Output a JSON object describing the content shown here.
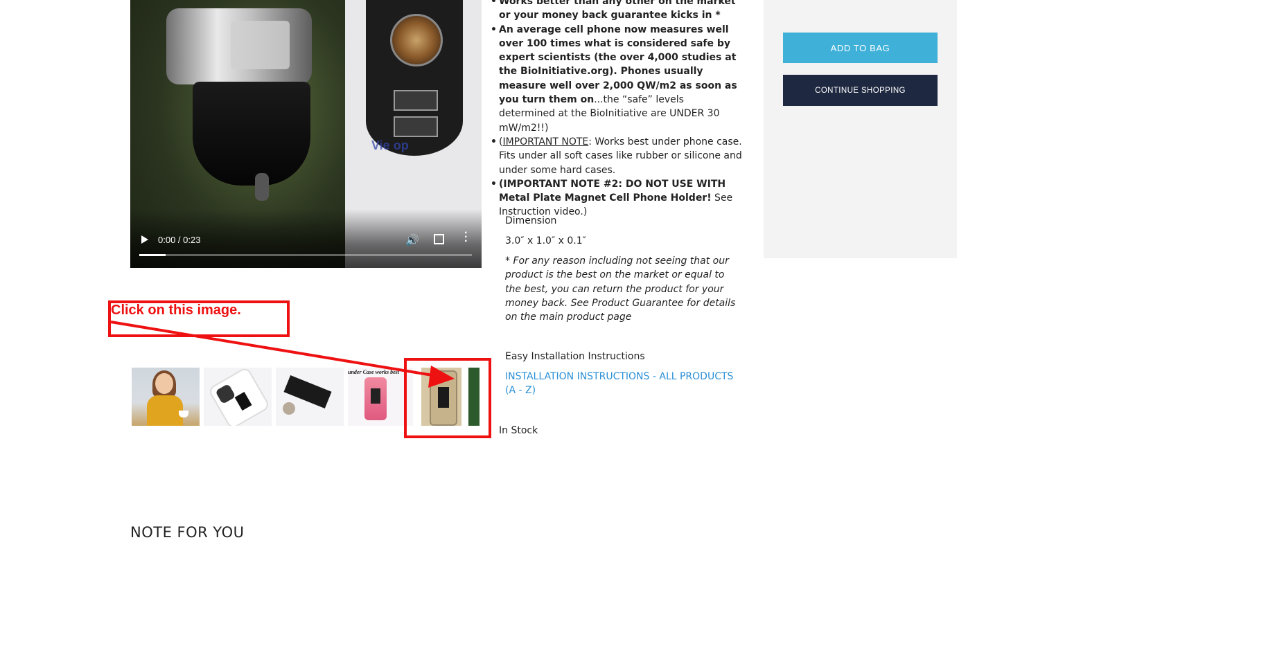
{
  "video": {
    "time": "0:00 / 0:23",
    "watermark": "Vie    op",
    "progress_fraction": 0.08
  },
  "annotation": {
    "text": "Click on this image."
  },
  "thumbnails": {
    "thumb4_caption": "under Case works best"
  },
  "description": {
    "bullet1": "Works better than any other on the market or your money back guarantee kicks in *",
    "bullet2_bold": "An average cell phone now measures well over 100 times what is considered safe by expert scientists (the over 4,000 studies at the BioInitiative.org). Phones usually measure well over 2,000 QW/m2 as soon as you turn them on",
    "bullet2_rest": "...the “safe” levels determined at the BioInitiative are UNDER 30 mW/m2!!)",
    "bullet3_open": "(",
    "bullet3_underlined": "IMPORTANT NOTE",
    "bullet3_rest": ":  Works best under phone case. Fits under all soft cases like rubber or silicone and under some hard cases.",
    "bullet4_bold": "(IMPORTANT NOTE #2:  DO NOT USE WITH Metal Plate Magnet Cell Phone Holder!",
    "bullet4_rest": "  See Instruction video.)",
    "dimension_label": "Dimension",
    "dimension_value": "3.0″ x 1.0″ x 0.1″",
    "guarantee_note": "* For any reason including not seeing that our product is the best on the market or equal to the best, you can return the product for your money back.  See Product Guarantee for details on the main product page",
    "install_heading": "Easy Installation Instructions",
    "install_link": "INSTALLATION INSTRUCTIONS - ALL PRODUCTS (A - Z)",
    "stock": "In Stock"
  },
  "sidebar": {
    "add_to_bag": "ADD TO BAG",
    "continue_shopping": "CONTINUE SHOPPING"
  },
  "note_heading": "NOTE FOR YOU",
  "colors": {
    "accent": "#3fb0d8",
    "dark_button": "#1e2840",
    "link": "#2a8fd6",
    "annotation": "#ee1111"
  }
}
